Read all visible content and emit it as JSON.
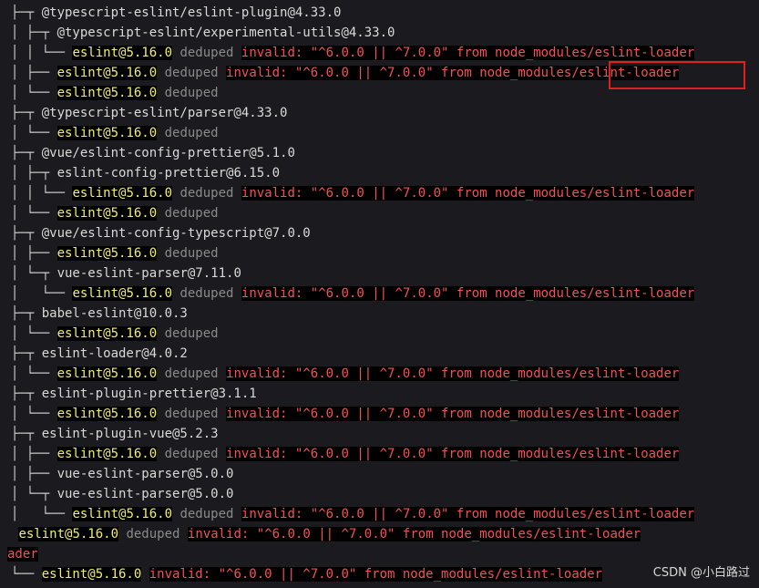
{
  "terminal": {
    "lines": [
      {
        "indent": "",
        "tree": "├─┬ ",
        "name": "@typescript-eslint/eslint-plugin@4.33.0"
      },
      {
        "indent": "│ ├─┬ ",
        "tree": "",
        "name": "@typescript-eslint/experimental-utils@4.33.0"
      },
      {
        "indent": "│ │ └── ",
        "tree": "",
        "name": "eslint@5.16.0",
        "deduped": "deduped",
        "invalid": "invalid: \"^6.0.0 || ^7.0.0\" from node_modules/eslint-loader",
        "hl": true
      },
      {
        "indent": "│ ├── ",
        "tree": "",
        "name": "eslint@5.16.0",
        "deduped": "deduped",
        "invalid": "invalid: \"^6.0.0 || ^7.0.0\" from node_modules/eslint-loader",
        "hl": true
      },
      {
        "indent": "│ └── ",
        "tree": "",
        "name": "eslint@5.16.0",
        "deduped": "deduped",
        "hl": true
      },
      {
        "indent": "├─┬ ",
        "tree": "",
        "name": "@typescript-eslint/parser@4.33.0"
      },
      {
        "indent": "│ └── ",
        "tree": "",
        "name": "eslint@5.16.0",
        "deduped": "deduped",
        "hl": true
      },
      {
        "indent": "├─┬ ",
        "tree": "",
        "name": "@vue/eslint-config-prettier@5.1.0"
      },
      {
        "indent": "│ ├─┬ ",
        "tree": "",
        "name": "eslint-config-prettier@6.15.0"
      },
      {
        "indent": "│ │ └── ",
        "tree": "",
        "name": "eslint@5.16.0",
        "deduped": "deduped",
        "invalid": "invalid: \"^6.0.0 || ^7.0.0\" from node_modules/eslint-loader",
        "hl": true
      },
      {
        "indent": "│ └── ",
        "tree": "",
        "name": "eslint@5.16.0",
        "deduped": "deduped",
        "hl": true
      },
      {
        "indent": "├─┬ ",
        "tree": "",
        "name": "@vue/eslint-config-typescript@7.0.0"
      },
      {
        "indent": "│ ├── ",
        "tree": "",
        "name": "eslint@5.16.0",
        "deduped": "deduped",
        "hl": true
      },
      {
        "indent": "│ └─┬ ",
        "tree": "",
        "name": "vue-eslint-parser@7.11.0"
      },
      {
        "indent": "│   └── ",
        "tree": "",
        "name": "eslint@5.16.0",
        "deduped": "deduped",
        "invalid": "invalid: \"^6.0.0 || ^7.0.0\" from node_modules/eslint-loader",
        "hl": true
      },
      {
        "indent": "├─┬ ",
        "tree": "",
        "name": "babel-eslint@10.0.3"
      },
      {
        "indent": "│ └── ",
        "tree": "",
        "name": "eslint@5.16.0",
        "deduped": "deduped",
        "hl": true
      },
      {
        "indent": "├─┬ ",
        "tree": "",
        "name": "eslint-loader@4.0.2"
      },
      {
        "indent": "│ └── ",
        "tree": "",
        "name": "eslint@5.16.0",
        "deduped": "deduped",
        "invalid": "invalid: \"^6.0.0 || ^7.0.0\" from node_modules/eslint-loader",
        "hl": true
      },
      {
        "indent": "├─┬ ",
        "tree": "",
        "name": "eslint-plugin-prettier@3.1.1"
      },
      {
        "indent": "│ └── ",
        "tree": "",
        "name": "eslint@5.16.0",
        "deduped": "deduped",
        "invalid": "invalid: \"^6.0.0 || ^7.0.0\" from node_modules/eslint-loader",
        "hl": true
      },
      {
        "indent": "├─┬ ",
        "tree": "",
        "name": "eslint-plugin-vue@5.2.3"
      },
      {
        "indent": "│ ├── ",
        "tree": "",
        "name": "eslint@5.16.0",
        "deduped": "deduped",
        "invalid": "invalid: \"^6.0.0 || ^7.0.0\" from node_modules/eslint-loader",
        "hl": true
      },
      {
        "indent": "│ ├── ",
        "tree": "",
        "name": "vue-eslint-parser@5.0.0"
      },
      {
        "indent": "│ └─┬ ",
        "tree": "",
        "name": "vue-eslint-parser@5.0.0"
      },
      {
        "indent": "│   └── ",
        "tree": "",
        "name": "eslint@5.16.0",
        "deduped": "deduped",
        "invalid": "invalid: \"^6.0.0 || ^7.0.0\" from node_modules/eslint-loader",
        "hl": true
      },
      {
        "indent": " ",
        "tree": "",
        "name": "eslint@5.16.0",
        "deduped": "deduped",
        "invalid": "invalid: \"^6.0.0 || ^7.0.0\" from node_modules/eslint-loader",
        "hl": true
      },
      {
        "indent": "",
        "tree": "",
        "name": "",
        "wrap": "ader"
      },
      {
        "indent": "└── ",
        "tree": "",
        "name": "eslint@5.16.0",
        "invalid": "invalid: \"^6.0.0 || ^7.0.0\" from node_modules/eslint-loader",
        "hl": true
      }
    ]
  },
  "watermark": "CSDN @小白路过"
}
